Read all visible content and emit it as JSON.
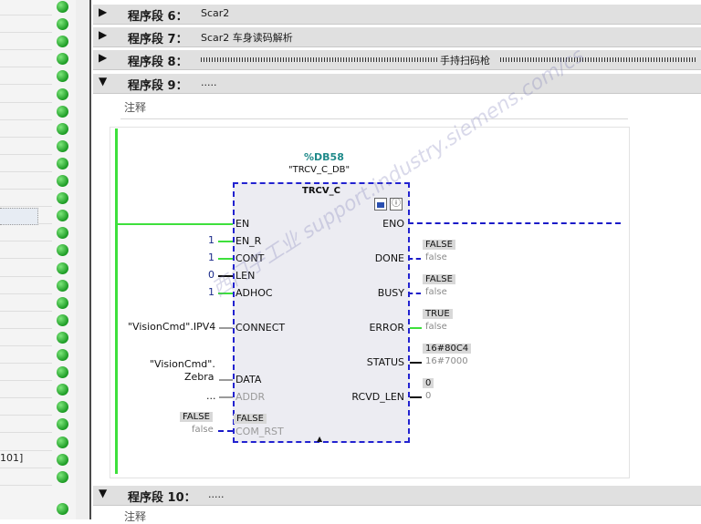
{
  "networks": [
    {
      "label": "程序段 6：",
      "comment": "Scar2"
    },
    {
      "label": "程序段 7：",
      "comment": "Scar2 车身读码解析"
    },
    {
      "label": "程序段 8：",
      "comment": "手持扫码枪"
    },
    {
      "label": "程序段 9：",
      "comment": "....."
    },
    {
      "label": "程序段 10：",
      "comment": "....."
    }
  ],
  "note_label": "注释",
  "left_panel": {
    "partial_label": "101]"
  },
  "fb": {
    "db_address": "%DB58",
    "db_name": "\"TRCV_C_DB\"",
    "type_name": "TRCV_C",
    "inputs": {
      "en": "EN",
      "en_r": "EN_R",
      "cont": "CONT",
      "len": "LEN",
      "adhoc": "ADHOC",
      "connect": "CONNECT",
      "data": "DATA",
      "addr": "ADDR",
      "com_rst": "COM_RST",
      "com_rst_value": "FALSE"
    },
    "input_values": {
      "en_r": "1",
      "cont": "1",
      "len": "0",
      "adhoc": "1",
      "connect": "\"VisionCmd\".IPV4",
      "data_line1": "\"VisionCmd\".",
      "data_line2": "Zebra",
      "addr": "...",
      "com_rst_badge": "FALSE",
      "com_rst_sub": "false"
    },
    "outputs": {
      "eno": "ENO",
      "done": "DONE",
      "busy": "BUSY",
      "error": "ERROR",
      "status": "STATUS",
      "rcvd_len": "RCVD_LEN"
    },
    "output_values": {
      "done_badge": "FALSE",
      "done_sub": "false",
      "busy_badge": "FALSE",
      "busy_sub": "false",
      "error_badge": "TRUE",
      "error_sub": "false",
      "status_badge": "16#80C4",
      "status_sub": "16#7000",
      "rcvd_badge": "0",
      "rcvd_sub": "0"
    }
  },
  "watermark": "西门子工业 support.industry.siemens.com/cs",
  "colors": {
    "powerflow": "#3ee03c",
    "status_ok": "#1c9b24",
    "selection": "#2222d0"
  }
}
